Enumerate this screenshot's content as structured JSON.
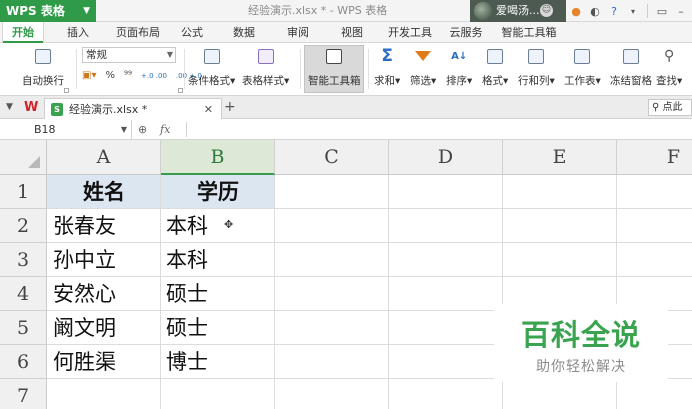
{
  "title_bar": {
    "app_name": "WPS 表格",
    "document_title": "经验演示.xlsx * - WPS 表格",
    "user_name": "爱喝汤..."
  },
  "ribbon_tabs": [
    {
      "label": "开始",
      "active": true
    },
    {
      "label": "插入"
    },
    {
      "label": "页面布局"
    },
    {
      "label": "公式"
    },
    {
      "label": "数据"
    },
    {
      "label": "审阅"
    },
    {
      "label": "视图"
    },
    {
      "label": "开发工具"
    },
    {
      "label": "云服务"
    },
    {
      "label": "智能工具箱"
    }
  ],
  "ribbon": {
    "autowrap": "自动换行",
    "number_format": "常规",
    "percent": "%",
    "comma": "⁹⁹",
    "decimal_inc": "+.0 .00",
    "decimal_dec": ".00 +.0",
    "cond_format": "条件格式",
    "table_style": "表格样式",
    "smart_toolbox": "智能工具箱",
    "sum": "求和",
    "filter": "筛选",
    "sort": "排序",
    "format": "格式",
    "row_col": "行和列",
    "worksheet": "工作表",
    "freeze": "冻结窗格",
    "find": "查找"
  },
  "doc_tabs": {
    "active_file": "经验演示.xlsx *",
    "search_placeholder": "点此"
  },
  "formula_bar": {
    "cell_ref": "B18",
    "fx": "fx"
  },
  "sheet": {
    "columns": [
      "A",
      "B",
      "C",
      "D",
      "E",
      "F"
    ],
    "rows": [
      "1",
      "2",
      "3",
      "4",
      "5",
      "6",
      "7"
    ],
    "header": {
      "name": "姓名",
      "education": "学历"
    },
    "records": [
      {
        "name": "张春友",
        "education": "本科"
      },
      {
        "name": "孙中立",
        "education": "本科"
      },
      {
        "name": "安然心",
        "education": "硕士"
      },
      {
        "name": "阚文明",
        "education": "硕士"
      },
      {
        "name": "何胜渠",
        "education": "博士"
      }
    ]
  },
  "watermark": {
    "title": "百科全说",
    "subtitle": "助你轻松解决"
  },
  "colors": {
    "accent": "#2f9a48",
    "header_fill": "#dce6f1"
  }
}
